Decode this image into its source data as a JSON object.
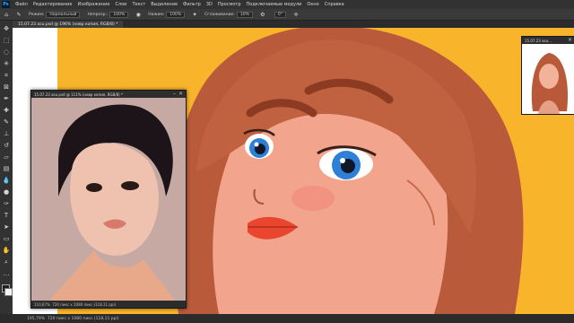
{
  "app": {
    "logo": "Ps"
  },
  "menu": [
    "Файл",
    "Редактирование",
    "Изображение",
    "Слои",
    "Текст",
    "Выделение",
    "Фильтр",
    "3D",
    "Просмотр",
    "Подключаемые модули",
    "Окно",
    "Справка"
  ],
  "options": {
    "mode_label": "Режим:",
    "mode_value": "Нормальный",
    "opacity_label": "Непрозр.:",
    "opacity_value": "100%",
    "flow_label": "Нажим:",
    "flow_value": "100%",
    "smoothing_label": "Сглаживание:",
    "smoothing_value": "10%",
    "angle_value": "0°"
  },
  "document_tab": "15.07.23 asu.psd @ 196% (новр копия, RGB/8) *",
  "reference_window": {
    "title": "15.07.23 asu.psd @ 111% (новр копия, RGB/8) *",
    "zoom": "110,67%",
    "size": "720 пикс x 1080 пикс (118,11 ppi)"
  },
  "navigator_window": {
    "title": "15.07.23 asu..."
  },
  "status": {
    "zoom": "195,79%",
    "size": "720 пикс x 1080 пикс (118,11 ppi)"
  },
  "colors": {
    "background": "#f9b62d",
    "ui_dark": "#282828",
    "accent": "#31a8ff"
  },
  "icons": [
    "move-icon",
    "marquee-icon",
    "lasso-icon",
    "quick-select-icon",
    "crop-icon",
    "frame-icon",
    "eyedropper-icon",
    "healing-icon",
    "brush-icon",
    "clone-stamp-icon",
    "history-brush-icon",
    "eraser-icon",
    "gradient-icon",
    "blur-icon",
    "dodge-icon",
    "pen-icon",
    "type-icon",
    "path-select-icon",
    "shape-icon",
    "hand-icon",
    "zoom-icon",
    "more-tools-icon"
  ]
}
